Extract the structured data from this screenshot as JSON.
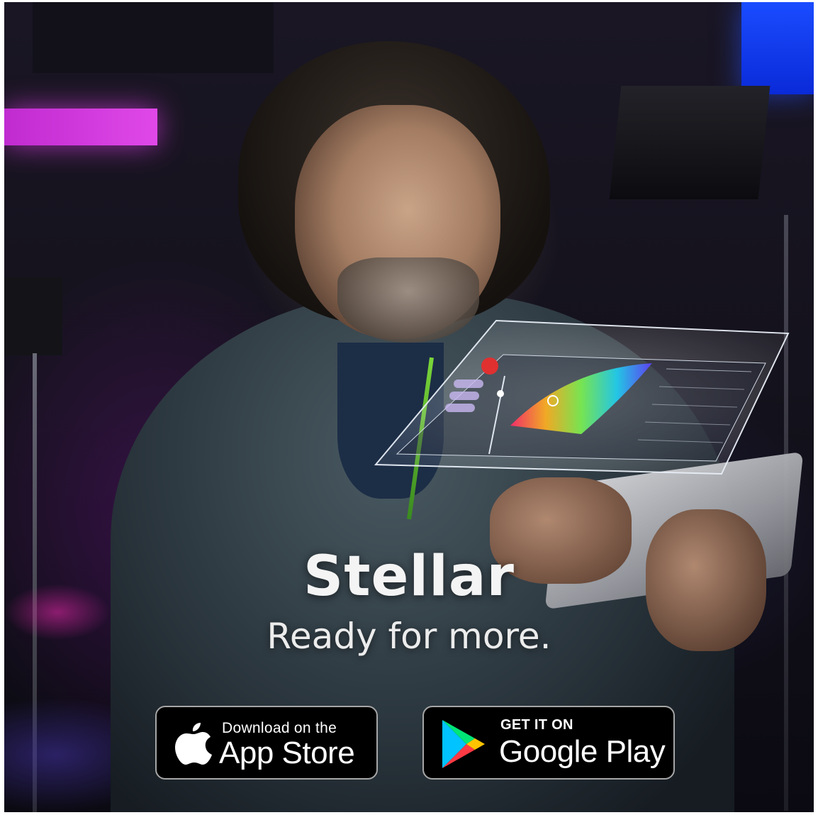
{
  "headline": "Stellar",
  "tagline": "Ready for more.",
  "badges": {
    "app_store": {
      "small": "Download on the",
      "big": "App Store"
    },
    "google_play": {
      "small": "GET IT ON",
      "big": "Google Play"
    }
  },
  "colors": {
    "magenta_light": "#e048e8",
    "blue_light": "#1a4cff",
    "badge_bg": "#000000",
    "badge_border": "#a6a6a6",
    "holo_accent": "#e03030"
  }
}
